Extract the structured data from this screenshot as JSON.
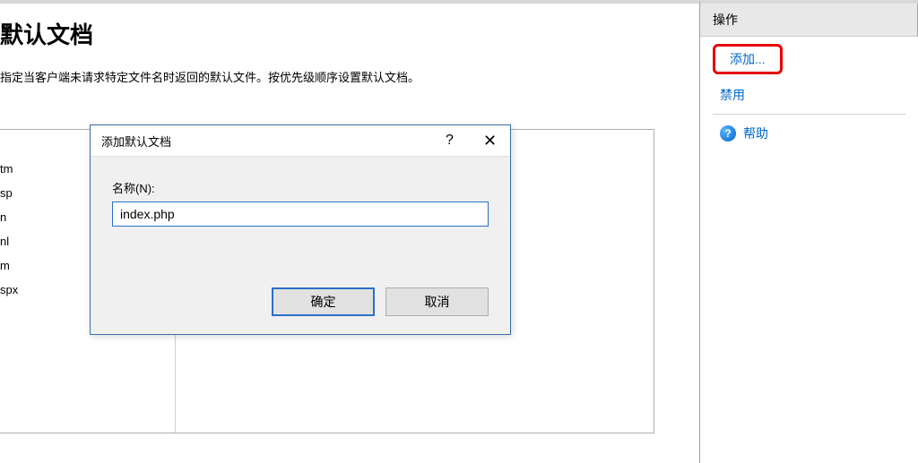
{
  "main": {
    "title": "默认文档",
    "description": "指定当客户端未请求特定文件名时返回的默认文件。按优先级顺序设置默认文档。",
    "items": [
      "tm",
      "sp",
      "n",
      "nl",
      "m",
      "spx"
    ]
  },
  "dialog": {
    "title": "添加默认文档",
    "help_symbol": "?",
    "close_symbol": "✕",
    "name_label": "名称(N):",
    "name_value": "index.php",
    "ok_label": "确定",
    "cancel_label": "取消"
  },
  "actions": {
    "header": "操作",
    "add": "添加...",
    "disable": "禁用",
    "help": "帮助",
    "help_symbol": "?"
  }
}
